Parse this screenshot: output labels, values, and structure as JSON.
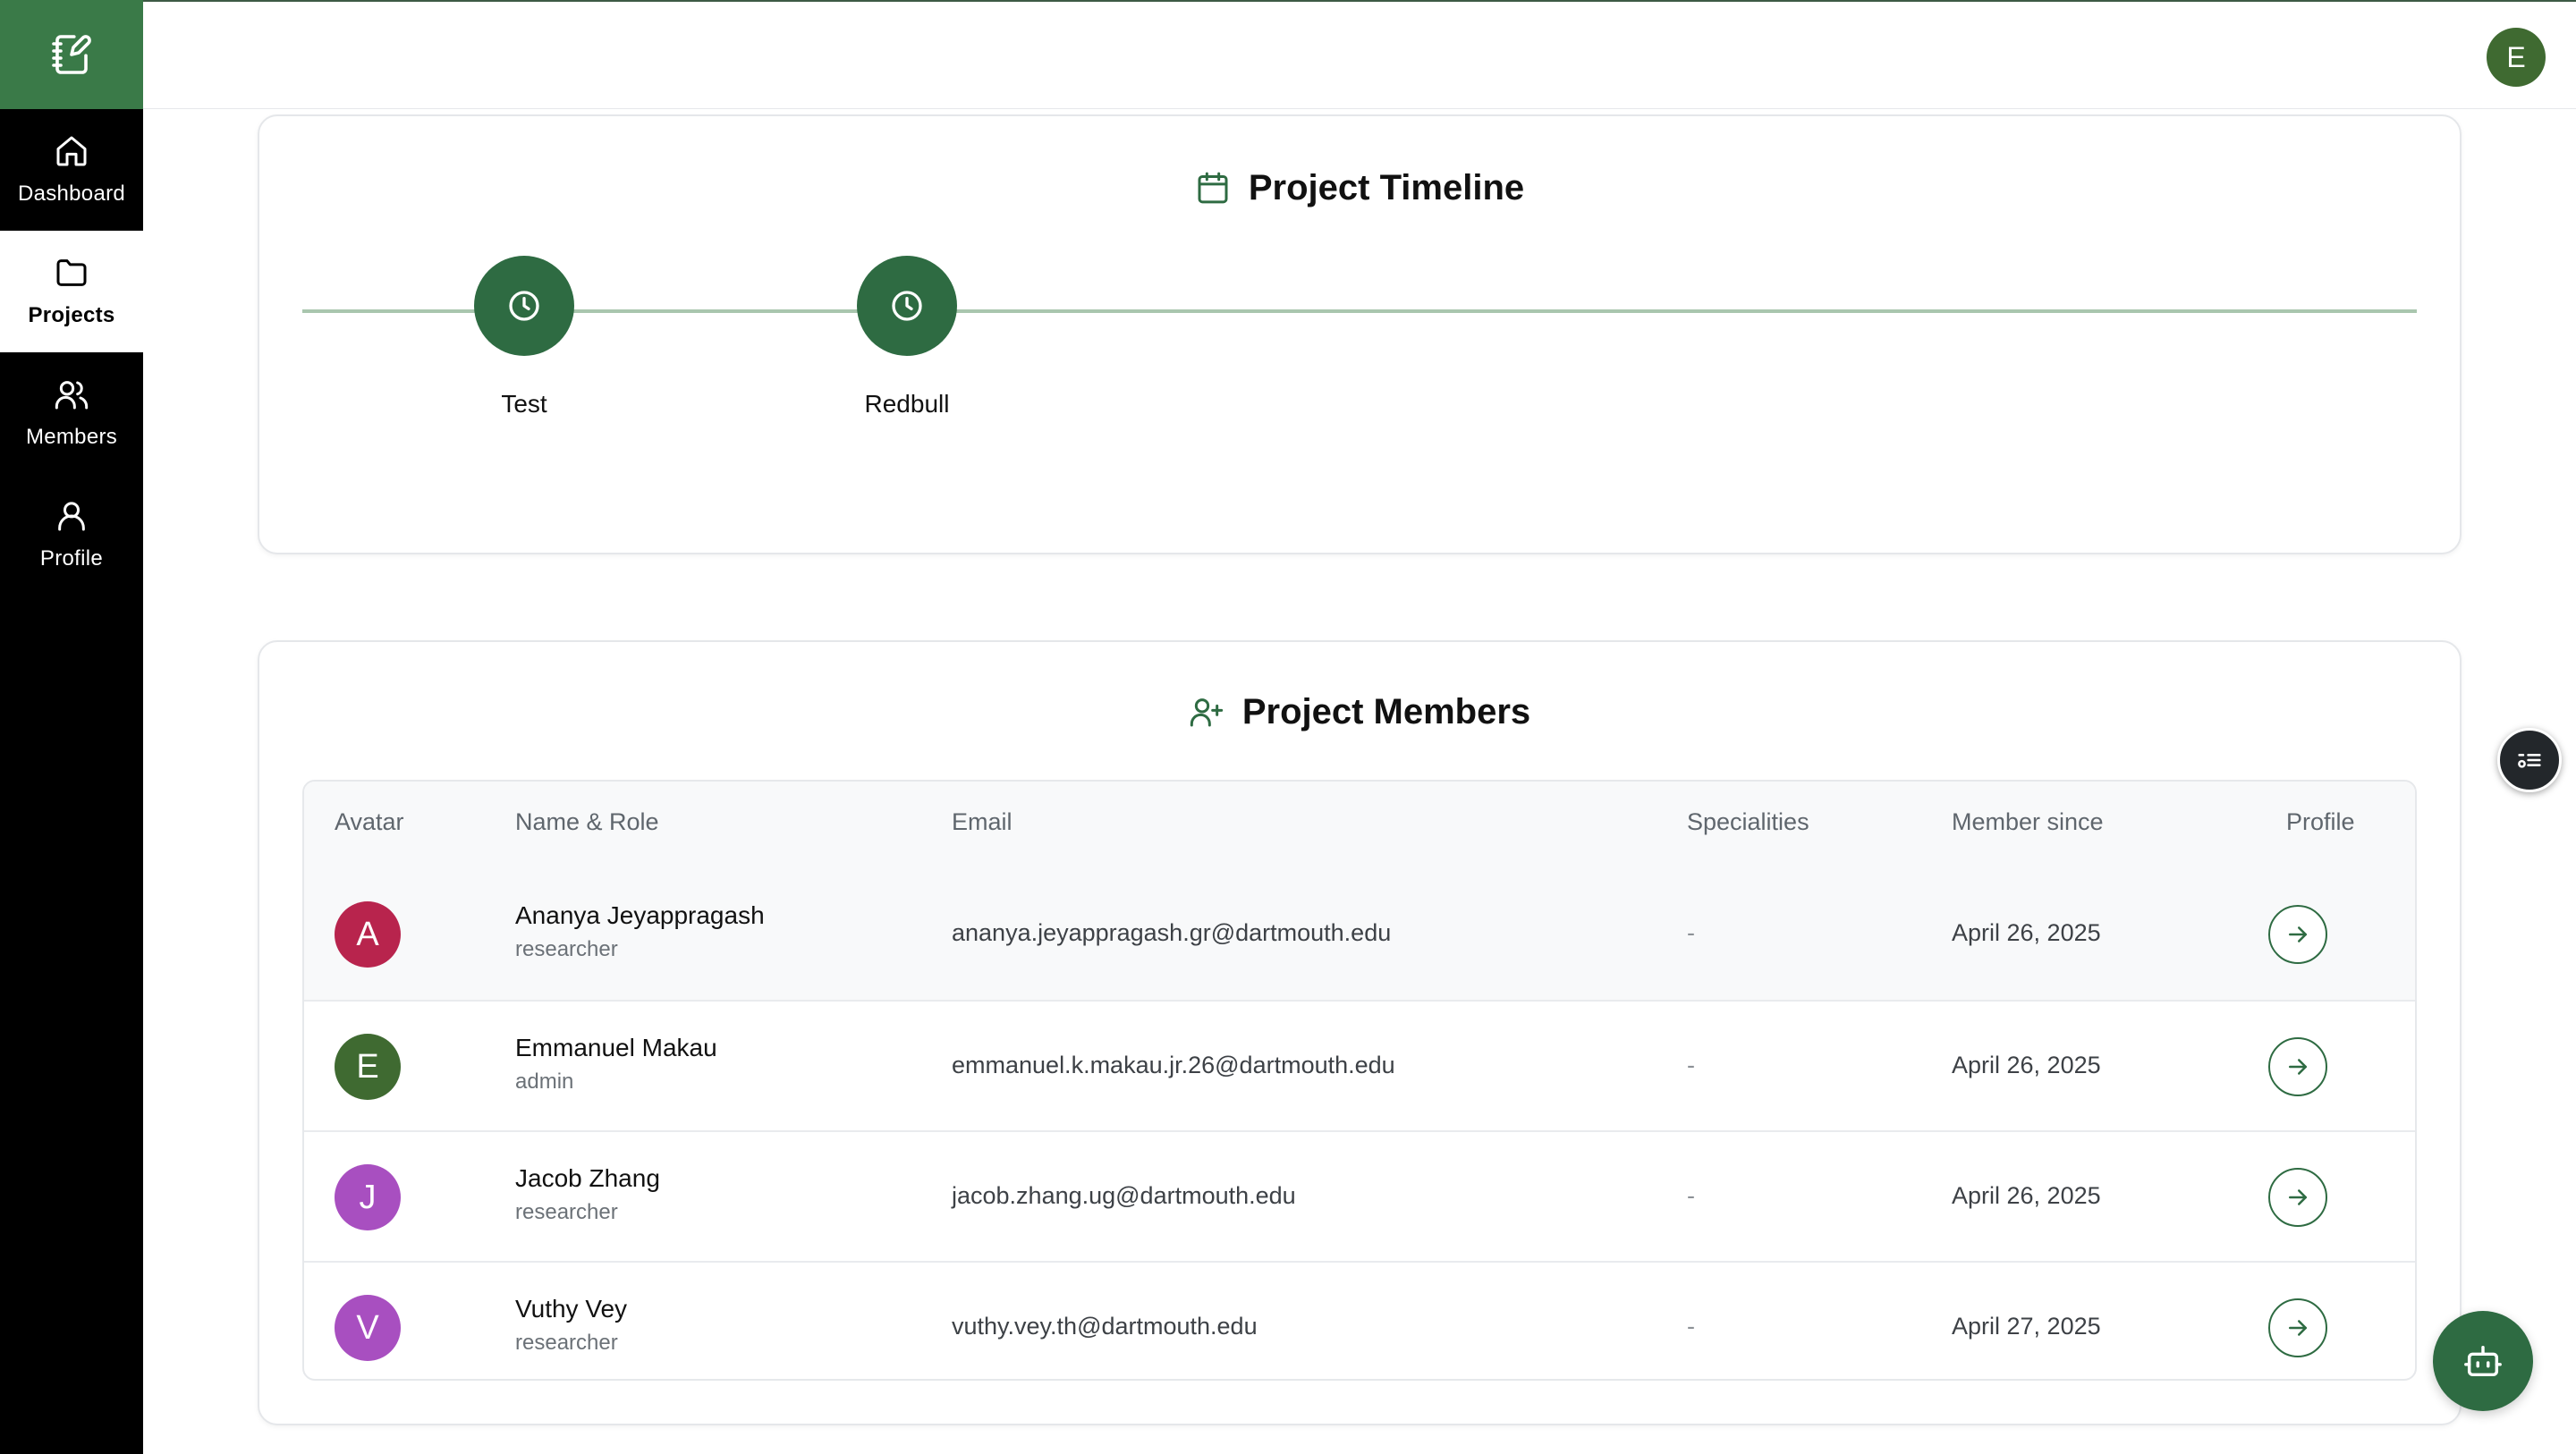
{
  "sidebar": {
    "logo_icon": "notebook-pen-icon",
    "items": [
      {
        "label": "Dashboard",
        "icon": "home-icon",
        "active": false
      },
      {
        "label": "Projects",
        "icon": "folder-icon",
        "active": true
      },
      {
        "label": "Members",
        "icon": "users-icon",
        "active": false
      },
      {
        "label": "Profile",
        "icon": "user-icon",
        "active": false
      }
    ]
  },
  "header": {
    "user_initial": "E",
    "avatar_color": "#3f6a31"
  },
  "timeline": {
    "title": "Project Timeline",
    "icon": "calendar-icon",
    "nodes": [
      {
        "label": "Test",
        "icon": "clock-icon"
      },
      {
        "label": "Redbull",
        "icon": "clock-icon"
      }
    ]
  },
  "members": {
    "title": "Project Members",
    "icon": "user-plus-icon",
    "columns": [
      "Avatar",
      "Name & Role",
      "Email",
      "Specialities",
      "Member since",
      "Profile"
    ],
    "rows": [
      {
        "initial": "A",
        "avatar_color": "#b8244d",
        "name": "Ananya Jeyappragash",
        "role": "researcher",
        "email": "ananya.jeyappragash.gr@dartmouth.edu",
        "specialities": "-",
        "member_since": "April 26, 2025"
      },
      {
        "initial": "E",
        "avatar_color": "#3f6a31",
        "name": "Emmanuel Makau",
        "role": "admin",
        "email": "emmanuel.k.makau.jr.26@dartmouth.edu",
        "specialities": "-",
        "member_since": "April 26, 2025"
      },
      {
        "initial": "J",
        "avatar_color": "#a84fc0",
        "name": "Jacob Zhang",
        "role": "researcher",
        "email": "jacob.zhang.ug@dartmouth.edu",
        "specialities": "-",
        "member_since": "April 26, 2025"
      },
      {
        "initial": "V",
        "avatar_color": "#a84fc0",
        "name": "Vuthy Vey",
        "role": "researcher",
        "email": "vuthy.vey.th@dartmouth.edu",
        "specialities": "-",
        "member_since": "April 27, 2025"
      }
    ]
  },
  "colors": {
    "brand_green": "#2e6b42",
    "logo_green": "#3a7a48",
    "timeline_line": "#a9c6ae"
  },
  "floating": {
    "side_widget_icon": "list-toggle-icon",
    "bot_icon": "bot-icon"
  }
}
